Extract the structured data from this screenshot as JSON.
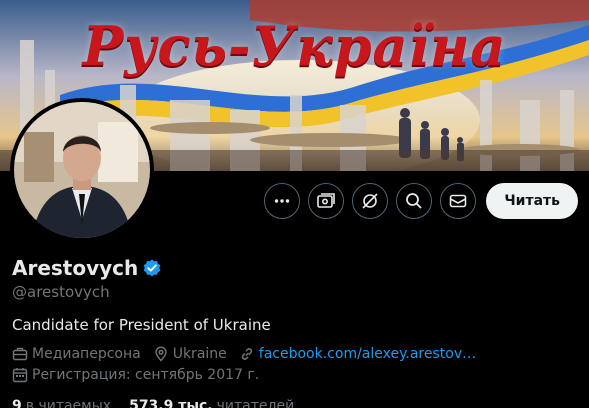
{
  "banner": {
    "title": "Русь-Україна"
  },
  "profile": {
    "display_name": "Arestovych",
    "handle": "@arestovych",
    "bio": "Candidate for President of Ukraine",
    "verified": true,
    "category": "Медиаперсона",
    "location": "Ukraine",
    "website": "facebook.com/alexey.arestov…",
    "joined": "Регистрация: сентябрь 2017 г."
  },
  "actions": {
    "more_icon": "more-icon",
    "subscribe_icon": "subscribe-icon",
    "grok_icon": "grok-icon",
    "search_icon": "search-icon",
    "message_icon": "envelope-icon",
    "follow_label": "Читать"
  },
  "stats": {
    "following_count": "9",
    "following_label": "в читаемых",
    "followers_count": "573,9 тыс.",
    "followers_label": "читателей"
  },
  "colors": {
    "accent": "#1d9bf0",
    "banner_title": "#c8161d"
  }
}
